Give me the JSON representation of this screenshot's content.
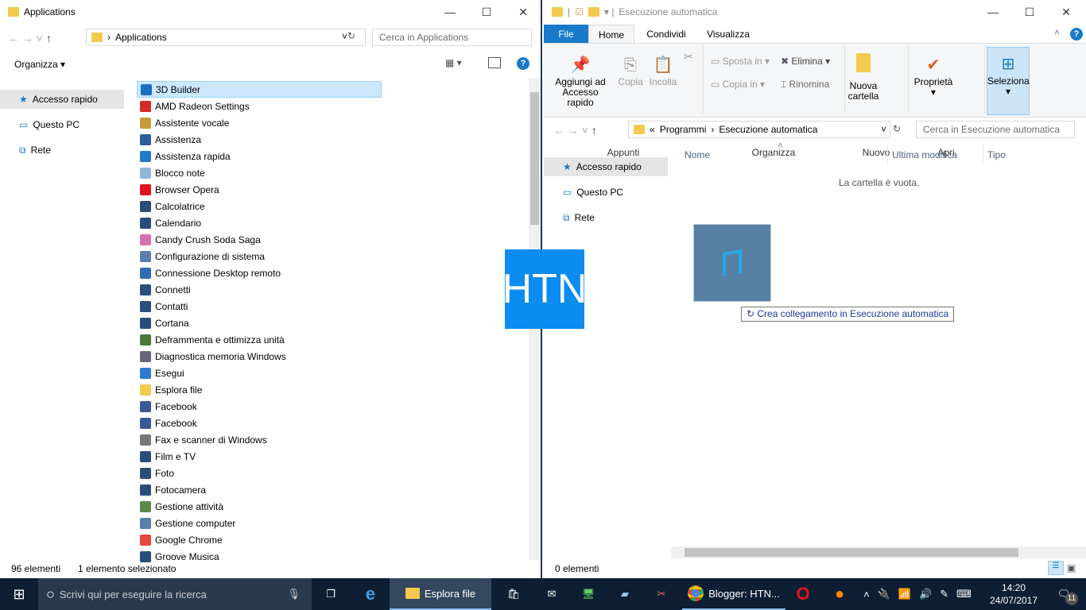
{
  "left": {
    "title": "Applications",
    "breadcrumb": "Applications",
    "search_placeholder": "Cerca in Applications",
    "organize": "Organizza",
    "nav": [
      "Accesso rapido",
      "Questo PC",
      "Rete"
    ],
    "items": [
      {
        "label": "3D Builder",
        "color": "#1a6fc0"
      },
      {
        "label": "AMD Radeon Settings",
        "color": "#d42a2a"
      },
      {
        "label": "Assistente vocale",
        "color": "#c59a3b"
      },
      {
        "label": "Assistenza",
        "color": "#2b5d9c"
      },
      {
        "label": "Assistenza rapida",
        "color": "#1f7bc8"
      },
      {
        "label": "Blocco note",
        "color": "#8fb8d8"
      },
      {
        "label": "Browser Opera",
        "color": "#e0141e"
      },
      {
        "label": "Calcolatrice",
        "color": "#2b4d7a"
      },
      {
        "label": "Calendario",
        "color": "#2b4d7a"
      },
      {
        "label": "Candy Crush Soda Saga",
        "color": "#d86fb0"
      },
      {
        "label": "Configurazione di sistema",
        "color": "#5a7fa8"
      },
      {
        "label": "Connessione Desktop remoto",
        "color": "#2f6fb0"
      },
      {
        "label": "Connetti",
        "color": "#2b4d7a"
      },
      {
        "label": "Contatti",
        "color": "#2b4d7a"
      },
      {
        "label": "Cortana",
        "color": "#2b4d7a"
      },
      {
        "label": "Deframmenta e ottimizza unità",
        "color": "#4a7a3a"
      },
      {
        "label": "Diagnostica memoria Windows",
        "color": "#667"
      },
      {
        "label": "Esegui",
        "color": "#2f7ad0"
      },
      {
        "label": "Esplora file",
        "color": "#f3c94f"
      },
      {
        "label": "Facebook",
        "color": "#3b5998"
      },
      {
        "label": "Facebook",
        "color": "#3b5998"
      },
      {
        "label": "Fax e scanner di Windows",
        "color": "#777"
      },
      {
        "label": "Film e TV",
        "color": "#2b4d7a"
      },
      {
        "label": "Foto",
        "color": "#2b4d7a"
      },
      {
        "label": "Fotocamera",
        "color": "#2b4d7a"
      },
      {
        "label": "Gestione attività",
        "color": "#5a8a4a"
      },
      {
        "label": "Gestione computer",
        "color": "#5a7fa8"
      },
      {
        "label": "Google Chrome",
        "color": "#e8453c"
      },
      {
        "label": "Groove Musica",
        "color": "#2b4d7a"
      }
    ],
    "status_count": "96 elementi",
    "status_selected": "1 elemento selezionato"
  },
  "right": {
    "title": "Esecuzione automatica",
    "tabs": [
      "File",
      "Home",
      "Condividi",
      "Visualizza"
    ],
    "ribbon": {
      "pin": "Aggiungi ad Accesso rapido",
      "copy": "Copia",
      "paste": "Incolla",
      "move": "Sposta in",
      "copyto": "Copia in",
      "delete": "Elimina",
      "rename": "Rinomina",
      "newfolder": "Nuova cartella",
      "props": "Proprietà",
      "select": "Seleziona",
      "groups": [
        "Appunti",
        "Organizza",
        "Nuovo",
        "Apri"
      ]
    },
    "breadcrumb": [
      "«",
      "Programmi",
      "Esecuzione automatica"
    ],
    "search_placeholder": "Cerca in Esecuzione automatica",
    "nav": [
      "Accesso rapido",
      "Questo PC",
      "Rete"
    ],
    "columns": [
      "Nome",
      "Ultima modifica",
      "Tipo"
    ],
    "empty": "La cartella è vuota.",
    "tooltip": "Crea collegamento in Esecuzione automatica",
    "status_count": "0 elementi"
  },
  "logo": "HTN",
  "taskbar": {
    "search": "Scrivi qui per eseguire la ricerca",
    "explorer": "Esplora file",
    "chrome": "Blogger: HTN...",
    "time": "14:20",
    "date": "24/07/2017",
    "notifications": "11"
  },
  "colors": {
    "accent": "#1979ca",
    "taskbar": "#0e1f33",
    "logo": "#0a8cf0",
    "selection": "#cce8ff"
  }
}
